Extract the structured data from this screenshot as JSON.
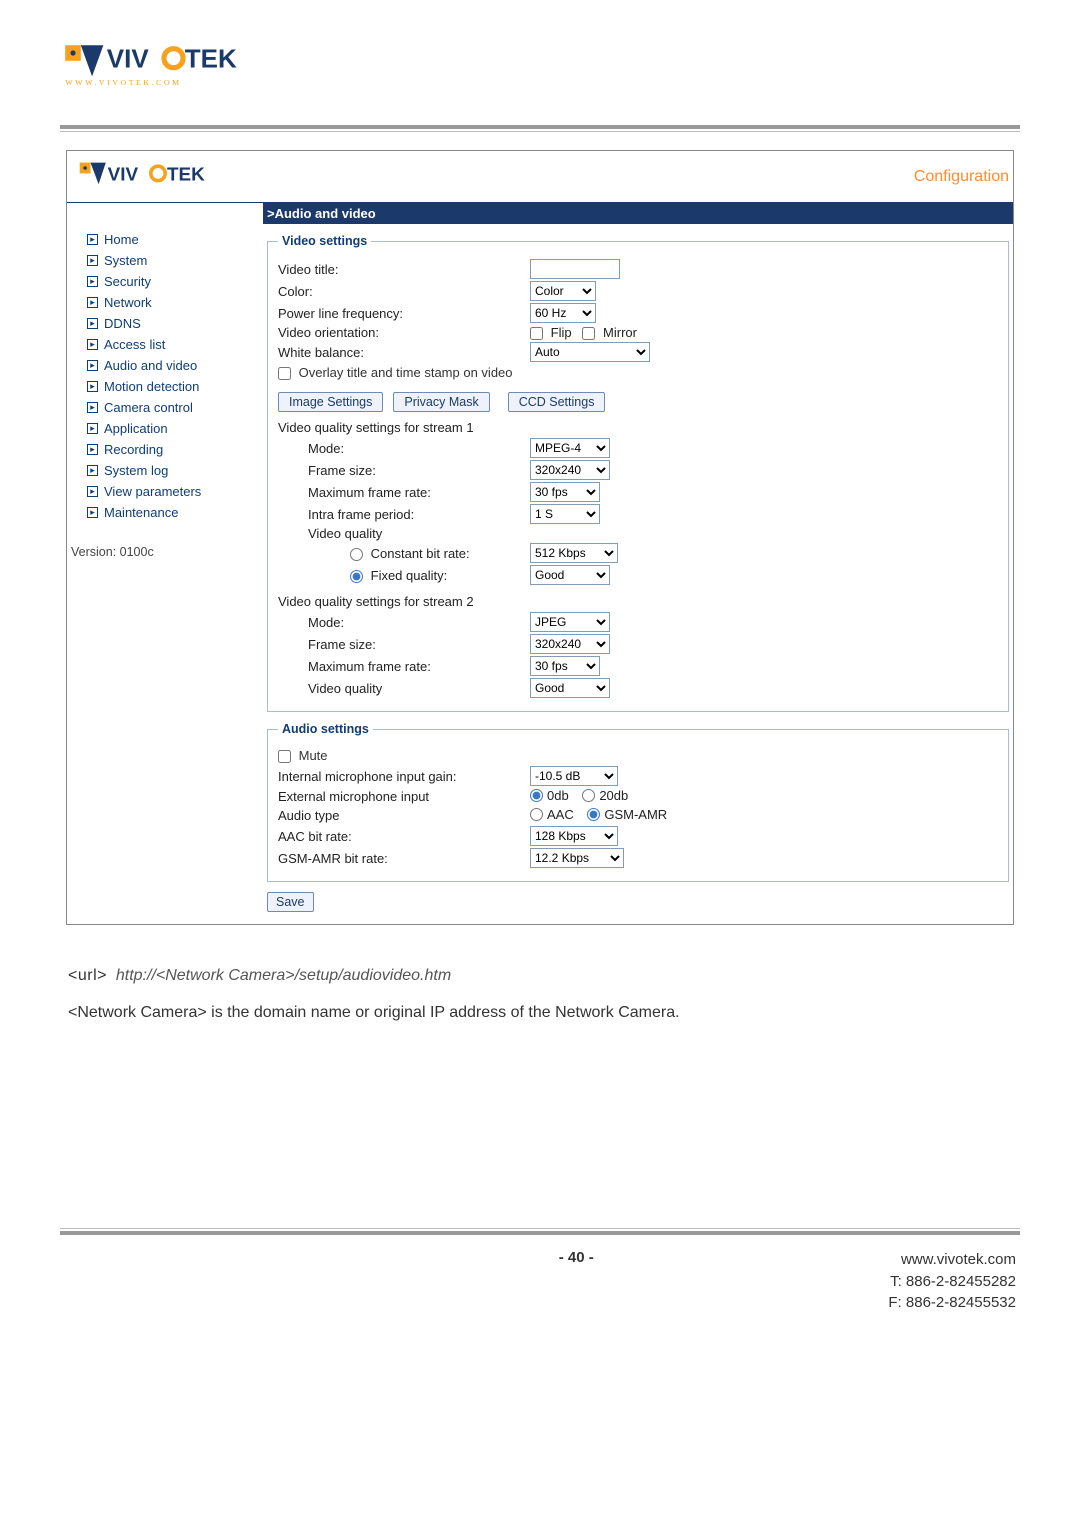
{
  "brand": {
    "name": "VIVOTEK",
    "tag": "WWW.VIVOTEK.COM"
  },
  "header": {
    "configuration_label": "Configuration",
    "page_title": ">Audio and video"
  },
  "sidebar": {
    "items": [
      {
        "label": "Home"
      },
      {
        "label": "System"
      },
      {
        "label": "Security"
      },
      {
        "label": "Network"
      },
      {
        "label": "DDNS"
      },
      {
        "label": "Access list"
      },
      {
        "label": "Audio and video"
      },
      {
        "label": "Motion detection"
      },
      {
        "label": "Camera control"
      },
      {
        "label": "Application"
      },
      {
        "label": "Recording"
      },
      {
        "label": "System log"
      },
      {
        "label": "View parameters"
      },
      {
        "label": "Maintenance"
      }
    ],
    "version_label": "Version: 0100c"
  },
  "video": {
    "legend": "Video settings",
    "labels": {
      "video_title": "Video title:",
      "color": "Color:",
      "plf": "Power line frequency:",
      "orientation": "Video orientation:",
      "wb": "White balance:",
      "overlay": "Overlay title and time stamp on video"
    },
    "values": {
      "video_title": "",
      "color": "Color",
      "plf": "60 Hz",
      "flip_label": "Flip",
      "mirror_label": "Mirror",
      "flip_checked": false,
      "mirror_checked": false,
      "wb": "Auto",
      "overlay_checked": false
    },
    "buttons": {
      "image_settings": "Image Settings",
      "privacy_mask": "Privacy Mask",
      "ccd_settings": "CCD Settings"
    },
    "stream1": {
      "section": "Video quality settings for stream 1",
      "labels": {
        "mode": "Mode:",
        "frame_size": "Frame size:",
        "max_fr": "Maximum frame rate:",
        "intra": "Intra frame period:",
        "vq": "Video quality",
        "cbr": "Constant bit rate:",
        "fq": "Fixed quality:"
      },
      "values": {
        "mode": "MPEG-4",
        "frame_size": "320x240",
        "max_fr": "30 fps",
        "intra": "1 S",
        "vq_mode_cbr": false,
        "vq_mode_fq": true,
        "cbr": "512 Kbps",
        "fq": "Good"
      }
    },
    "stream2": {
      "section": "Video quality settings for stream 2",
      "labels": {
        "mode": "Mode:",
        "frame_size": "Frame size:",
        "max_fr": "Maximum frame rate:",
        "vq": "Video quality"
      },
      "values": {
        "mode": "JPEG",
        "frame_size": "320x240",
        "max_fr": "30 fps",
        "vq": "Good"
      }
    }
  },
  "audio": {
    "legend": "Audio settings",
    "labels": {
      "mute": "Mute",
      "mic_gain": "Internal microphone input gain:",
      "ext_mic": "External microphone input",
      "audio_type": "Audio type",
      "aac_bitrate": "AAC bit rate:",
      "gsm_bitrate": "GSM-AMR bit rate:"
    },
    "values": {
      "mute_checked": false,
      "mic_gain": "-10.5 dB",
      "ext_0db_label": "0db",
      "ext_20db_label": "20db",
      "ext_selected": "0db",
      "type_aac_label": "AAC",
      "type_gsm_label": "GSM-AMR",
      "type_selected": "GSM-AMR",
      "aac_bitrate": "128 Kbps",
      "gsm_bitrate": "12.2 Kbps"
    }
  },
  "save_label": "Save",
  "doc": {
    "url_prefix": "<url>",
    "url_value": "http://<Network Camera>/setup/audiovideo.htm",
    "note": "<Network Camera> is the domain name or original IP address of the Network Camera."
  },
  "footer": {
    "page_number": "- 40 -",
    "site": "www.vivotek.com",
    "tel": "T: 886-2-82455282",
    "fax": "F: 886-2-82455532"
  }
}
